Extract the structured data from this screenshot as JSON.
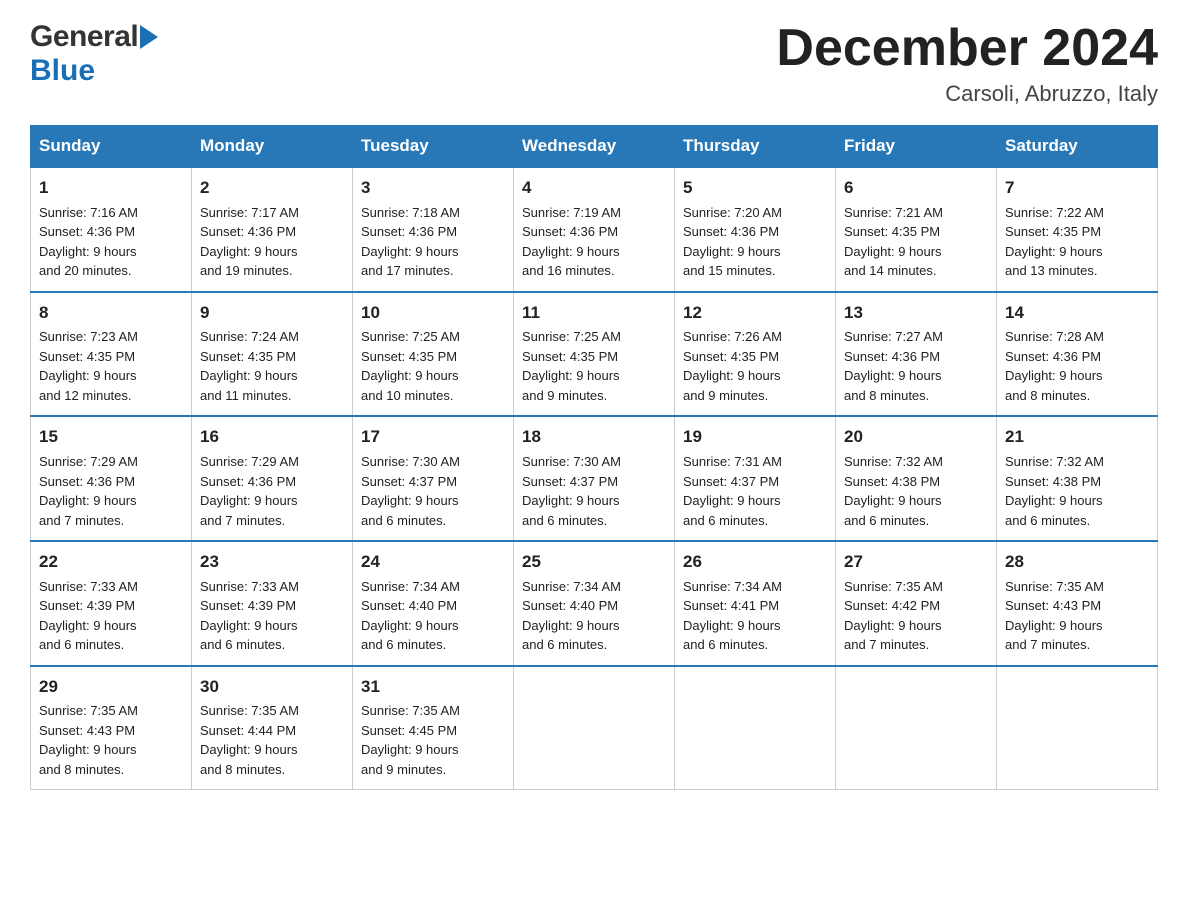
{
  "logo": {
    "general": "General",
    "blue": "Blue",
    "line1": "General",
    "line2": "Blue"
  },
  "header": {
    "month_year": "December 2024",
    "location": "Carsoli, Abruzzo, Italy"
  },
  "weekdays": [
    "Sunday",
    "Monday",
    "Tuesday",
    "Wednesday",
    "Thursday",
    "Friday",
    "Saturday"
  ],
  "weeks": [
    [
      {
        "day": "1",
        "sunrise": "7:16 AM",
        "sunset": "4:36 PM",
        "daylight": "9 hours and 20 minutes."
      },
      {
        "day": "2",
        "sunrise": "7:17 AM",
        "sunset": "4:36 PM",
        "daylight": "9 hours and 19 minutes."
      },
      {
        "day": "3",
        "sunrise": "7:18 AM",
        "sunset": "4:36 PM",
        "daylight": "9 hours and 17 minutes."
      },
      {
        "day": "4",
        "sunrise": "7:19 AM",
        "sunset": "4:36 PM",
        "daylight": "9 hours and 16 minutes."
      },
      {
        "day": "5",
        "sunrise": "7:20 AM",
        "sunset": "4:36 PM",
        "daylight": "9 hours and 15 minutes."
      },
      {
        "day": "6",
        "sunrise": "7:21 AM",
        "sunset": "4:35 PM",
        "daylight": "9 hours and 14 minutes."
      },
      {
        "day": "7",
        "sunrise": "7:22 AM",
        "sunset": "4:35 PM",
        "daylight": "9 hours and 13 minutes."
      }
    ],
    [
      {
        "day": "8",
        "sunrise": "7:23 AM",
        "sunset": "4:35 PM",
        "daylight": "9 hours and 12 minutes."
      },
      {
        "day": "9",
        "sunrise": "7:24 AM",
        "sunset": "4:35 PM",
        "daylight": "9 hours and 11 minutes."
      },
      {
        "day": "10",
        "sunrise": "7:25 AM",
        "sunset": "4:35 PM",
        "daylight": "9 hours and 10 minutes."
      },
      {
        "day": "11",
        "sunrise": "7:25 AM",
        "sunset": "4:35 PM",
        "daylight": "9 hours and 9 minutes."
      },
      {
        "day": "12",
        "sunrise": "7:26 AM",
        "sunset": "4:35 PM",
        "daylight": "9 hours and 9 minutes."
      },
      {
        "day": "13",
        "sunrise": "7:27 AM",
        "sunset": "4:36 PM",
        "daylight": "9 hours and 8 minutes."
      },
      {
        "day": "14",
        "sunrise": "7:28 AM",
        "sunset": "4:36 PM",
        "daylight": "9 hours and 8 minutes."
      }
    ],
    [
      {
        "day": "15",
        "sunrise": "7:29 AM",
        "sunset": "4:36 PM",
        "daylight": "9 hours and 7 minutes."
      },
      {
        "day": "16",
        "sunrise": "7:29 AM",
        "sunset": "4:36 PM",
        "daylight": "9 hours and 7 minutes."
      },
      {
        "day": "17",
        "sunrise": "7:30 AM",
        "sunset": "4:37 PM",
        "daylight": "9 hours and 6 minutes."
      },
      {
        "day": "18",
        "sunrise": "7:30 AM",
        "sunset": "4:37 PM",
        "daylight": "9 hours and 6 minutes."
      },
      {
        "day": "19",
        "sunrise": "7:31 AM",
        "sunset": "4:37 PM",
        "daylight": "9 hours and 6 minutes."
      },
      {
        "day": "20",
        "sunrise": "7:32 AM",
        "sunset": "4:38 PM",
        "daylight": "9 hours and 6 minutes."
      },
      {
        "day": "21",
        "sunrise": "7:32 AM",
        "sunset": "4:38 PM",
        "daylight": "9 hours and 6 minutes."
      }
    ],
    [
      {
        "day": "22",
        "sunrise": "7:33 AM",
        "sunset": "4:39 PM",
        "daylight": "9 hours and 6 minutes."
      },
      {
        "day": "23",
        "sunrise": "7:33 AM",
        "sunset": "4:39 PM",
        "daylight": "9 hours and 6 minutes."
      },
      {
        "day": "24",
        "sunrise": "7:34 AM",
        "sunset": "4:40 PM",
        "daylight": "9 hours and 6 minutes."
      },
      {
        "day": "25",
        "sunrise": "7:34 AM",
        "sunset": "4:40 PM",
        "daylight": "9 hours and 6 minutes."
      },
      {
        "day": "26",
        "sunrise": "7:34 AM",
        "sunset": "4:41 PM",
        "daylight": "9 hours and 6 minutes."
      },
      {
        "day": "27",
        "sunrise": "7:35 AM",
        "sunset": "4:42 PM",
        "daylight": "9 hours and 7 minutes."
      },
      {
        "day": "28",
        "sunrise": "7:35 AM",
        "sunset": "4:43 PM",
        "daylight": "9 hours and 7 minutes."
      }
    ],
    [
      {
        "day": "29",
        "sunrise": "7:35 AM",
        "sunset": "4:43 PM",
        "daylight": "9 hours and 8 minutes."
      },
      {
        "day": "30",
        "sunrise": "7:35 AM",
        "sunset": "4:44 PM",
        "daylight": "9 hours and 8 minutes."
      },
      {
        "day": "31",
        "sunrise": "7:35 AM",
        "sunset": "4:45 PM",
        "daylight": "9 hours and 9 minutes."
      },
      {
        "day": "",
        "sunrise": "",
        "sunset": "",
        "daylight": ""
      },
      {
        "day": "",
        "sunrise": "",
        "sunset": "",
        "daylight": ""
      },
      {
        "day": "",
        "sunrise": "",
        "sunset": "",
        "daylight": ""
      },
      {
        "day": "",
        "sunrise": "",
        "sunset": "",
        "daylight": ""
      }
    ]
  ],
  "labels": {
    "sunrise": "Sunrise:",
    "sunset": "Sunset:",
    "daylight": "Daylight:"
  }
}
